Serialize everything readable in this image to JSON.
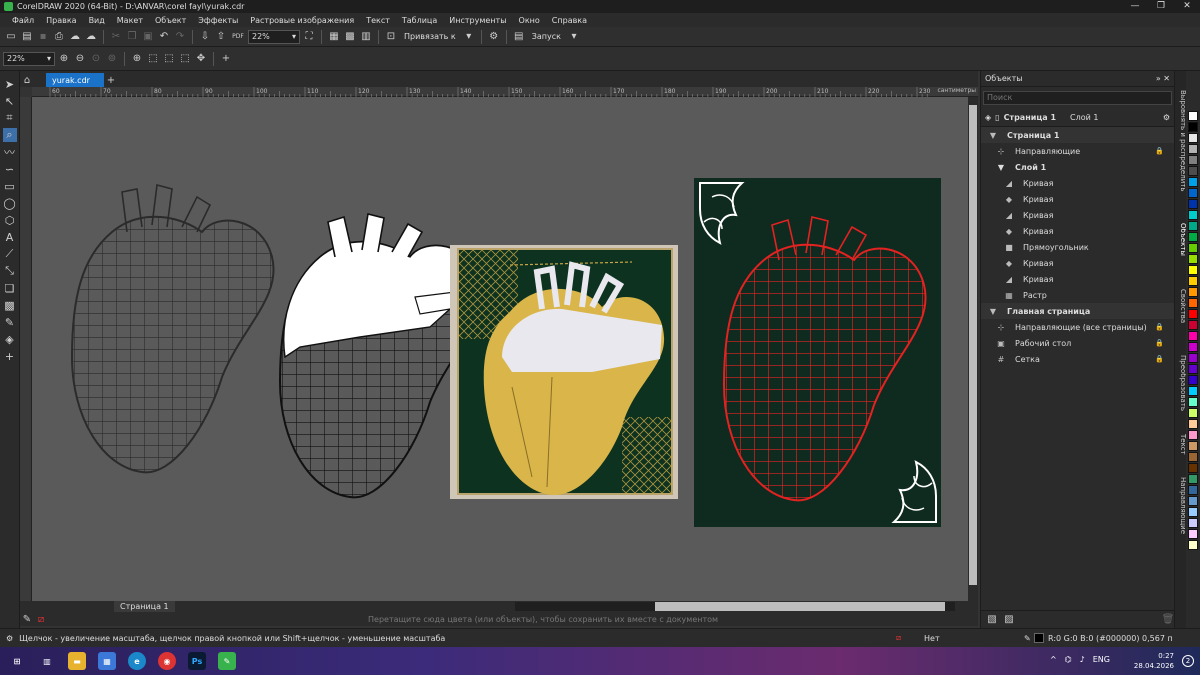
{
  "window": {
    "title": "CorelDRAW 2020 (64-Bit) - D:\\ANVAR\\corel fayl\\yurak.cdr",
    "minimize": "—",
    "maximize": "❐",
    "close": "✕"
  },
  "menu": [
    "Файл",
    "Правка",
    "Вид",
    "Макет",
    "Объект",
    "Эффекты",
    "Растровые изображения",
    "Текст",
    "Таблица",
    "Инструменты",
    "Окно",
    "Справка"
  ],
  "toolbar": {
    "zoom_value": "22%",
    "snap_label": "Привязать к",
    "launch_label": "Запуск",
    "pdf_label": "PDF"
  },
  "propbar": {
    "zoom_value": "22%"
  },
  "document": {
    "tab_label": "yurak.cdr",
    "page_tab": "Страница 1",
    "ruler_unit": "сантиметры",
    "ruler_ticks": [
      "60",
      "70",
      "80",
      "90",
      "100",
      "110",
      "120",
      "130",
      "140",
      "150",
      "160",
      "170",
      "180",
      "190",
      "200",
      "210",
      "220",
      "230"
    ],
    "color_hint": "Перетащите сюда цвета (или объекты), чтобы сохранить их вместе с документом"
  },
  "docker": {
    "title": "Объекты",
    "search_placeholder": "Поиск",
    "page_label": "Страница 1",
    "layer_label": "Слой 1",
    "rows": [
      {
        "label": "Страница 1",
        "type": "page-header",
        "icon": "▼"
      },
      {
        "label": "Направляющие",
        "type": "guides",
        "icon": "⊹"
      },
      {
        "label": "Слой 1",
        "type": "layer",
        "icon": "▼"
      },
      {
        "label": "Кривая",
        "type": "curve",
        "icon": "◢"
      },
      {
        "label": "Кривая",
        "type": "curve",
        "icon": "◆"
      },
      {
        "label": "Кривая",
        "type": "curve",
        "icon": "◢"
      },
      {
        "label": "Кривая",
        "type": "curve",
        "icon": "◆"
      },
      {
        "label": "Прямоугольник",
        "type": "rect",
        "icon": "■"
      },
      {
        "label": "Кривая",
        "type": "curve",
        "icon": "◆"
      },
      {
        "label": "Кривая",
        "type": "curve",
        "icon": "◢"
      },
      {
        "label": "Растр",
        "type": "bitmap",
        "icon": "▦"
      },
      {
        "label": "Главная страница",
        "type": "page-header",
        "icon": "▼"
      },
      {
        "label": "Направляющие (все страницы)",
        "type": "guides",
        "icon": "⊹"
      },
      {
        "label": "Рабочий стол",
        "type": "desktop",
        "icon": "▣"
      },
      {
        "label": "Сетка",
        "type": "grid",
        "icon": "#"
      }
    ]
  },
  "side_tabs": [
    "Выровнять и распределить",
    "Объекты",
    "Свойства",
    "Преобразовать",
    "Текст",
    "Направляющие"
  ],
  "palette": [
    "#ffffff",
    "#000000",
    "#e6e6e6",
    "#b3b3b3",
    "#808080",
    "#4d4d4d",
    "#00a0e9",
    "#0066cc",
    "#0033aa",
    "#00cccc",
    "#00aa88",
    "#00aa44",
    "#66cc00",
    "#99dd00",
    "#ffff00",
    "#ffcc00",
    "#ff9900",
    "#ff6600",
    "#ff0000",
    "#cc0033",
    "#ff00aa",
    "#cc00cc",
    "#9900cc",
    "#6600cc",
    "#3300cc",
    "#00ccff",
    "#66ffcc",
    "#ccff66",
    "#ffcc99",
    "#ff99cc",
    "#cc9966",
    "#996633",
    "#663300",
    "#339966",
    "#336699",
    "#6699cc",
    "#99ccff",
    "#ccccff",
    "#ffccff",
    "#ffffcc"
  ],
  "status": {
    "hint": "Щелчок - увеличение масштаба, щелчок правой кнопкой или Shift+щелчок - уменьшение масштаба",
    "fill": "Нет",
    "outline": "R:0 G:0 B:0 (#000000)  0,567 п"
  },
  "taskbar": {
    "lang": "ENG",
    "time": "0:27",
    "date": "28.04.2026",
    "badge": "2"
  }
}
